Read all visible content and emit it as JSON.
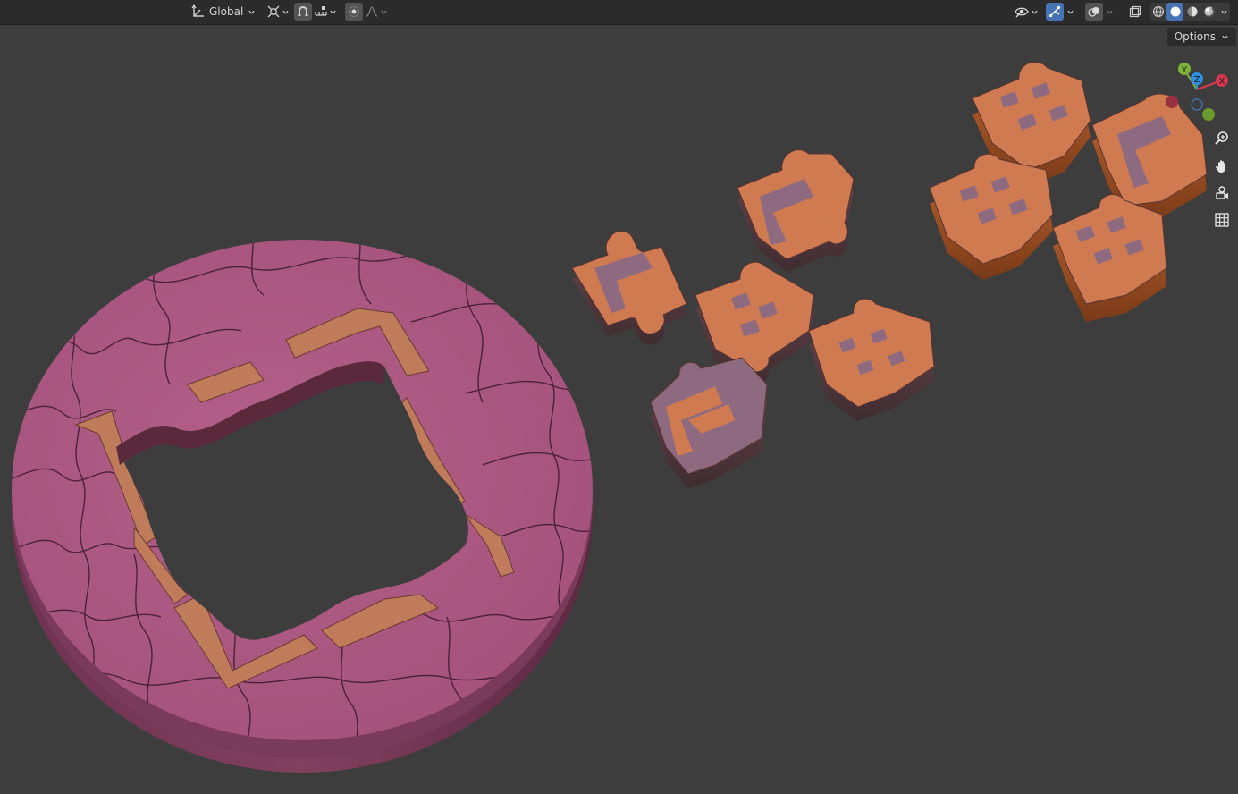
{
  "header": {
    "transform_orientation": "Global",
    "options_label": "Options"
  },
  "gizmo": {
    "x_label": "X",
    "y_label": "Y",
    "z_label": "Z"
  },
  "icons": [
    "transform-orientation-icon",
    "pivot-icon",
    "snap-icon",
    "snap-target-icon",
    "proportional-edit-icon",
    "falloff-icon",
    "visibility-icon",
    "gizmo-icon",
    "overlay-icon",
    "xray-icon",
    "wireframe-shading-icon",
    "solid-shading-icon",
    "material-shading-icon",
    "rendered-shading-icon",
    "zoom-icon",
    "pan-icon",
    "camera-icon",
    "grid-icon"
  ],
  "colors": {
    "viewport_bg": "#3d3d3d",
    "header_bg": "#2b2b2b",
    "disc": "#b05a86",
    "piece_orange": "#d07a52",
    "piece_mauve": "#8e6a80",
    "axis_x": "#d6394f",
    "axis_y": "#7fb337",
    "axis_z": "#2e8fe3"
  }
}
